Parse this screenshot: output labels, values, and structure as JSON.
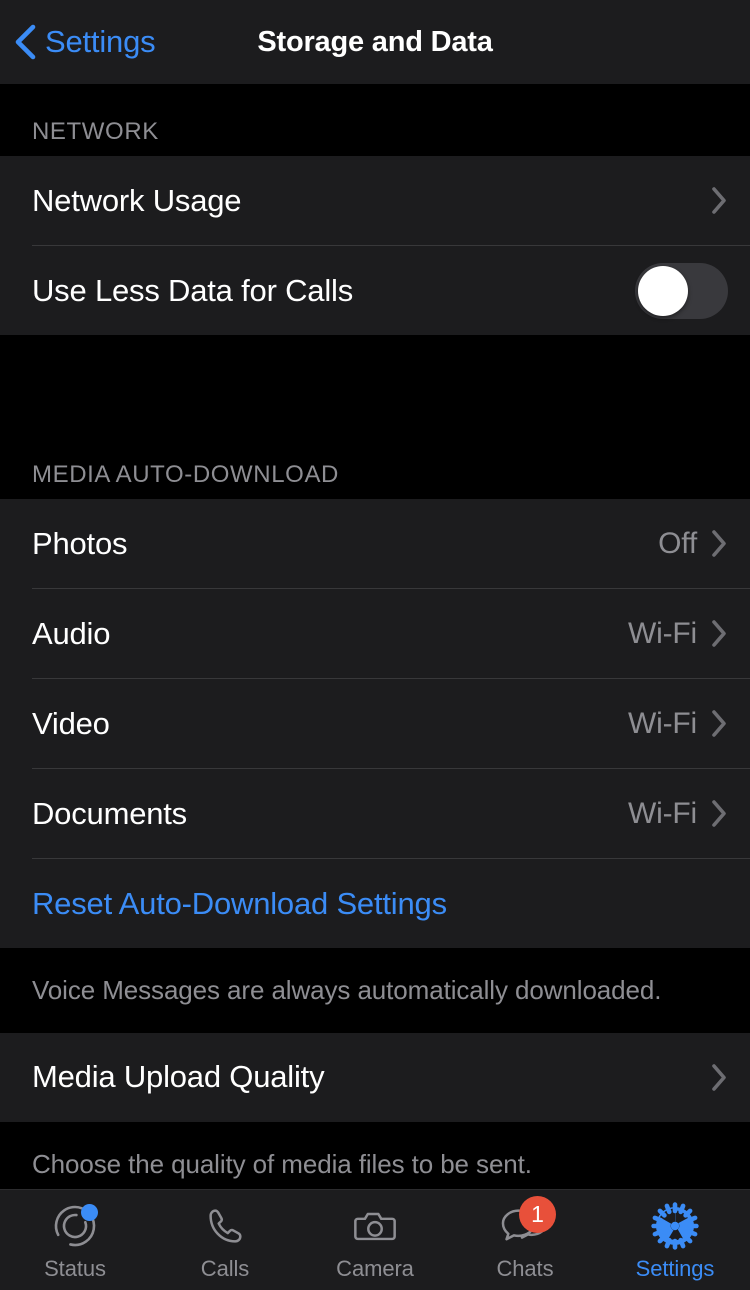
{
  "navbar": {
    "back_label": "Settings",
    "back_icon": "chevron-left-icon",
    "title": "Storage and Data"
  },
  "sections": {
    "network": {
      "header": "NETWORK",
      "rows": [
        {
          "label": "Network Usage",
          "accessory": "chevron-right-icon"
        },
        {
          "label": "Use Less Data for Calls",
          "accessory": "toggle",
          "toggle_on": false
        }
      ]
    },
    "media_auto_download": {
      "header": "MEDIA AUTO-DOWNLOAD",
      "rows": [
        {
          "label": "Photos",
          "value": "Off",
          "accessory": "chevron-right-icon"
        },
        {
          "label": "Audio",
          "value": "Wi-Fi",
          "accessory": "chevron-right-icon"
        },
        {
          "label": "Video",
          "value": "Wi-Fi",
          "accessory": "chevron-right-icon"
        },
        {
          "label": "Documents",
          "value": "Wi-Fi",
          "accessory": "chevron-right-icon"
        }
      ],
      "reset_label": "Reset Auto-Download Settings",
      "footnote": "Voice Messages are always automatically downloaded."
    },
    "media_upload_quality": {
      "row_label": "Media Upload Quality",
      "accessory": "chevron-right-icon",
      "footnote": "Choose the quality of media files to be sent."
    }
  },
  "tabbar": {
    "items": [
      {
        "label": "Status",
        "icon": "status-rings-icon",
        "badge_dot": true,
        "active": false
      },
      {
        "label": "Calls",
        "icon": "phone-icon",
        "active": false
      },
      {
        "label": "Camera",
        "icon": "camera-icon",
        "active": false
      },
      {
        "label": "Chats",
        "icon": "chat-bubbles-icon",
        "badge_count": "1",
        "active": false
      },
      {
        "label": "Settings",
        "icon": "gear-icon",
        "active": true
      }
    ]
  },
  "colors": {
    "accent_blue": "#3b8cf6",
    "badge_red": "#e8503a",
    "row_bg": "#1c1c1e",
    "page_bg": "#000000",
    "secondary_text": "#8e8e93",
    "separator": "#38383a"
  }
}
